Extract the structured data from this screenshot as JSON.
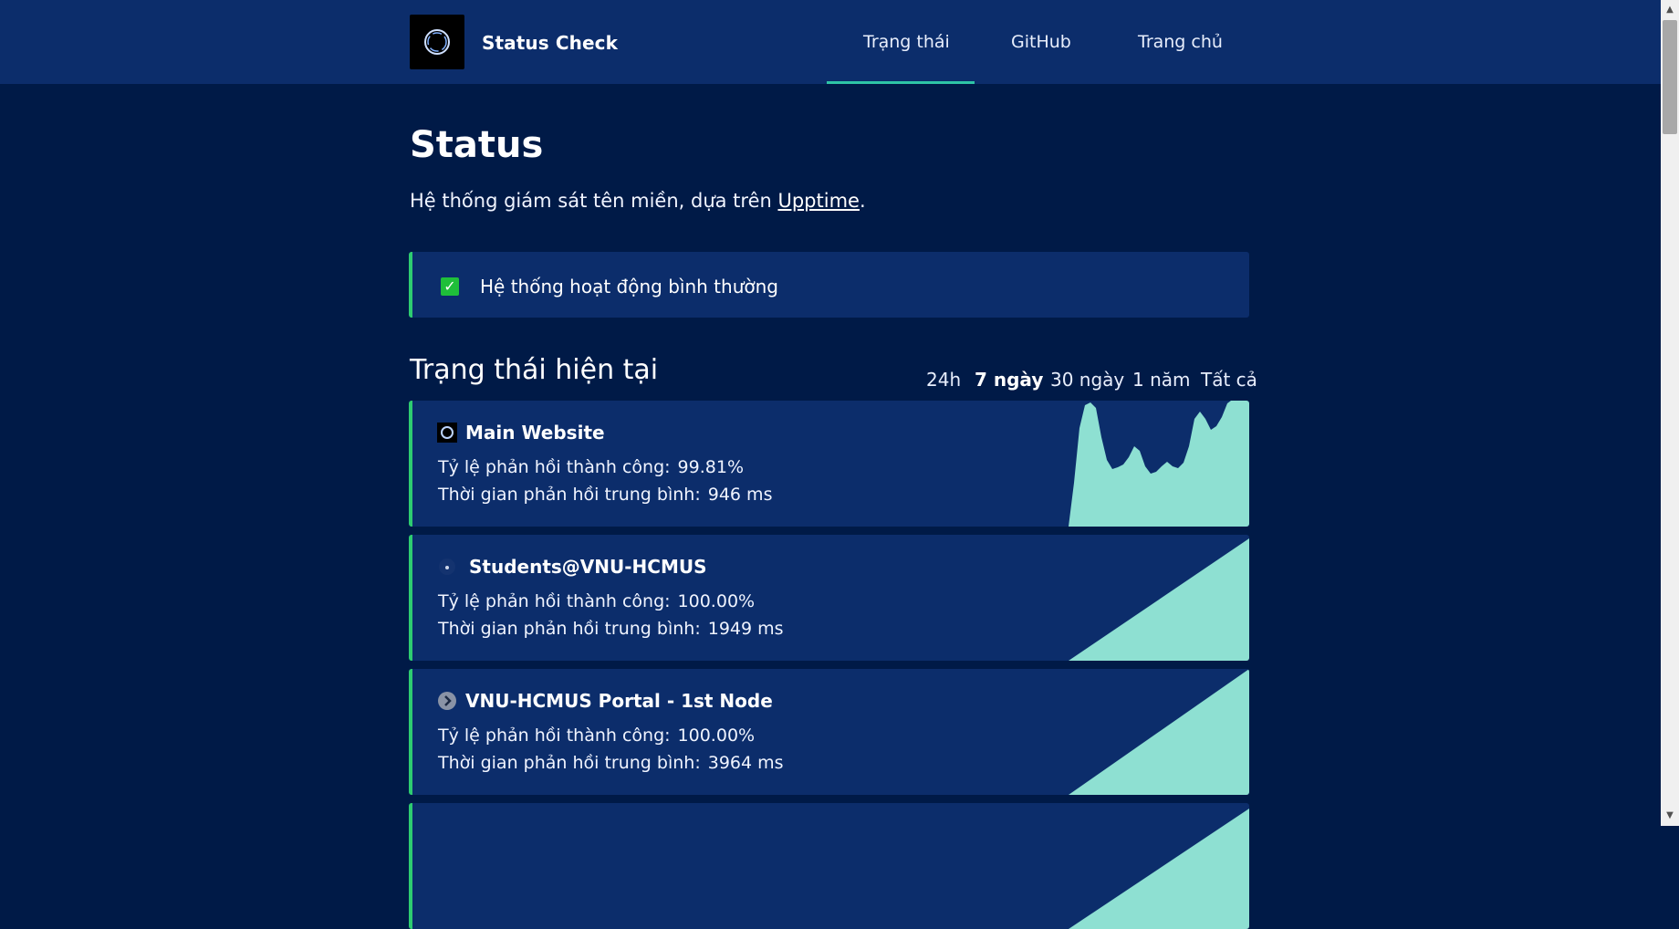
{
  "header": {
    "brand": "Status Check",
    "nav": [
      "Trạng thái",
      "GitHub",
      "Trang chủ"
    ],
    "active_nav": "Trạng thái"
  },
  "main": {
    "title": "Status",
    "intro_prefix": "Hệ thống giám sát tên miền, dựa trên ",
    "intro_link": "Upptime",
    "intro_suffix": ".",
    "banner": "Hệ thống hoạt động bình thường",
    "section_title": "Trạng thái hiện tại",
    "ranges": [
      "24h",
      "7 ngày",
      "30 ngày",
      "1 năm",
      "Tất cả"
    ],
    "active_range": "7 ngày",
    "uptime_label": "Tỷ lệ phản hồi thành công:",
    "response_label": "Thời gian phản hồi trung bình:",
    "sites": [
      {
        "name": "Main Website",
        "uptime": "99.81%",
        "response": "946 ms",
        "icon": "ring-logo-icon"
      },
      {
        "name": "Students@VNU-HCMUS",
        "uptime": "100.00%",
        "response": "1949 ms",
        "icon": "tiny-favicon-icon"
      },
      {
        "name": "VNU-HCMUS Portal - 1st Node",
        "uptime": "100.00%",
        "response": "3964 ms",
        "icon": "chevron-circle-icon"
      }
    ]
  },
  "colors": {
    "background": "#001a47",
    "header": "#0c2d6b",
    "card": "#0c2d6b",
    "accent_green": "#2ecc71",
    "sparkline": "#8ee0d2"
  }
}
